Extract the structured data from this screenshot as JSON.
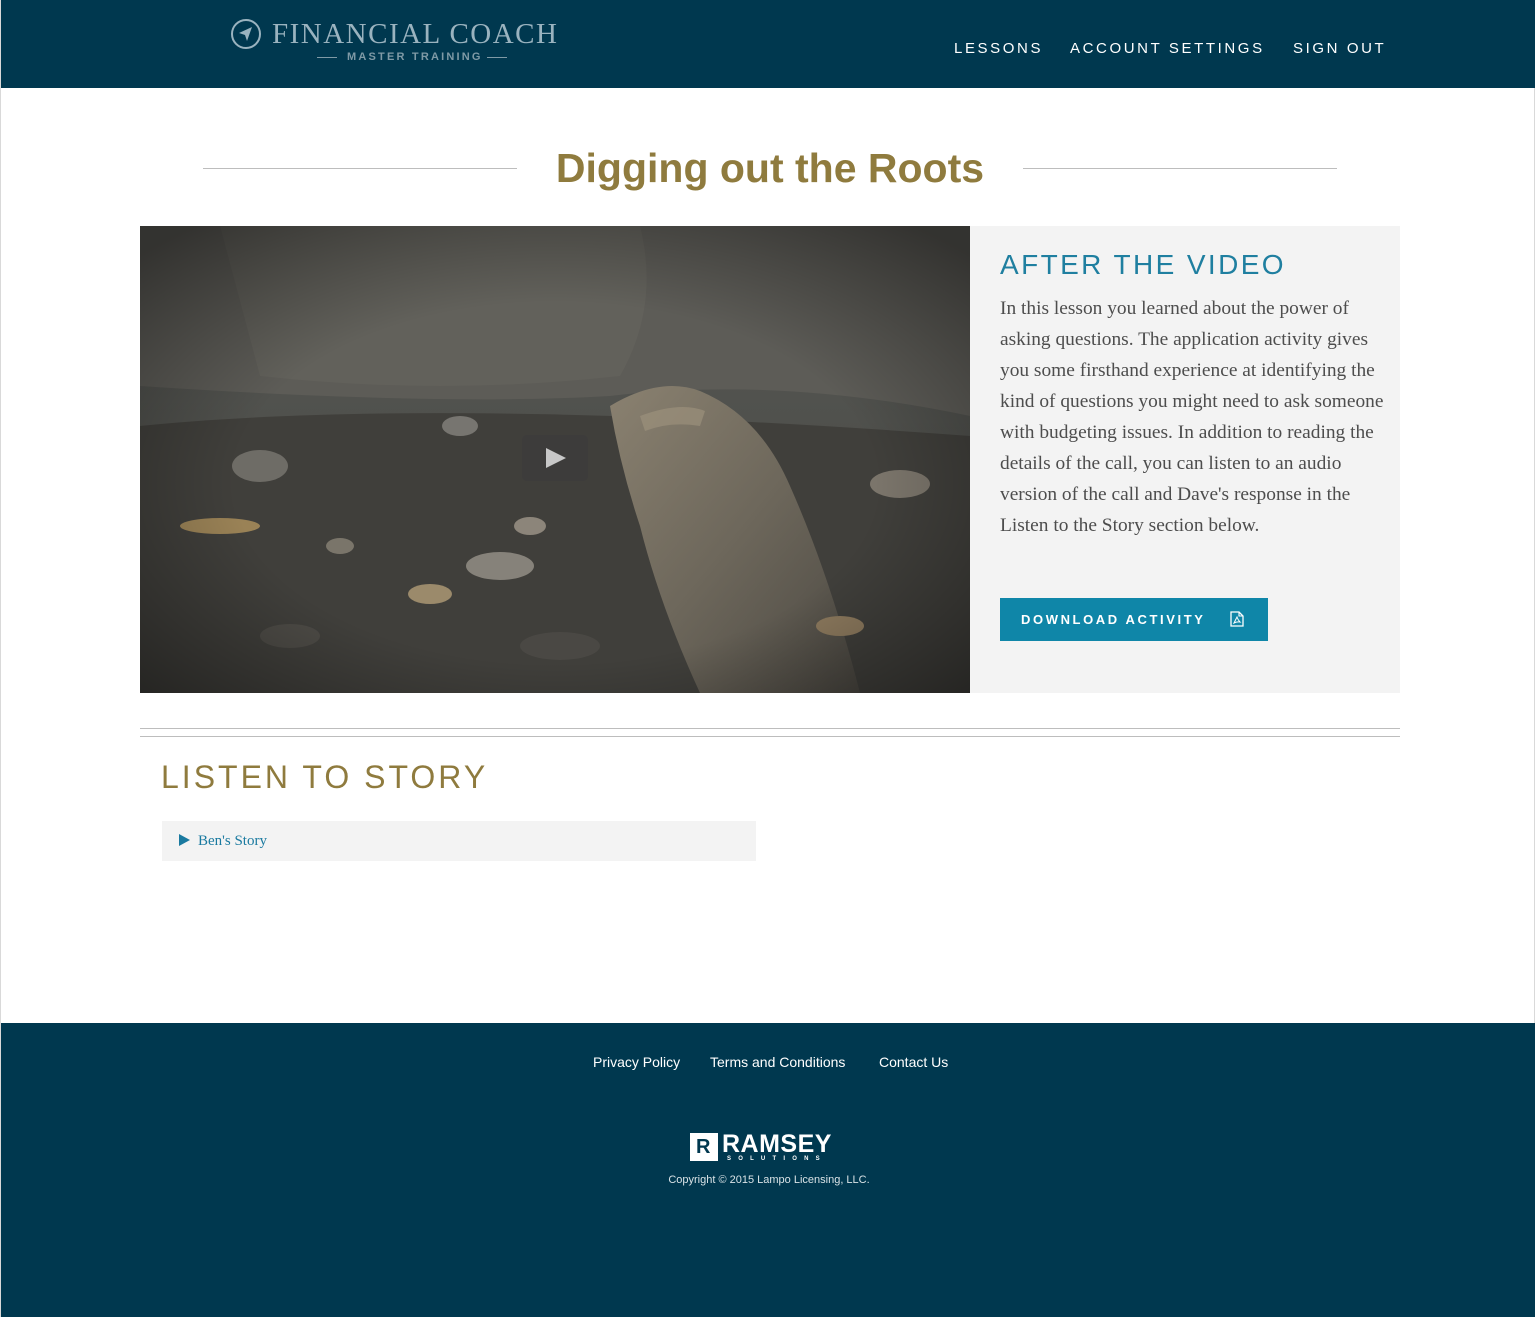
{
  "header": {
    "logo": {
      "title": "FINANCIAL COACH",
      "subtitle": "MASTER TRAINING",
      "icon": "paper-plane-compass-icon"
    },
    "nav": [
      {
        "label": "LESSONS"
      },
      {
        "label": "ACCOUNT SETTINGS"
      },
      {
        "label": "SIGN OUT"
      }
    ]
  },
  "lesson": {
    "title": "Digging out the Roots",
    "video": {
      "play_icon": "play-icon"
    },
    "after_video": {
      "heading": "AFTER THE VIDEO",
      "body": "In this lesson you learned about the power of asking questions. The application activity gives you some firsthand experience at identifying the kind of questions you might need to ask someone with budgeting issues. In addition to reading the details of the call, you can listen to an audio version of the call and Dave's response in the Listen to the Story section below.",
      "download_label": "DOWNLOAD ACTIVITY",
      "download_icon": "pdf-file-icon"
    },
    "listen": {
      "heading": "LISTEN TO STORY",
      "items": [
        {
          "label": "Ben's Story",
          "icon": "play-triangle-icon"
        }
      ]
    }
  },
  "footer": {
    "links": [
      {
        "label": "Privacy Policy"
      },
      {
        "label": "Terms and Conditions"
      },
      {
        "label": "Contact Us"
      }
    ],
    "brand": {
      "mark": "R",
      "name": "RAMSEY",
      "tagline": "SOLUTIONS"
    },
    "copyright": "Copyright © 2015 Lampo Licensing, LLC."
  },
  "colors": {
    "navy": "#00384f",
    "gold": "#8f7b3e",
    "teal": "#1f7fa0",
    "button": "#0f86a8",
    "panel": "#f3f3f3"
  }
}
